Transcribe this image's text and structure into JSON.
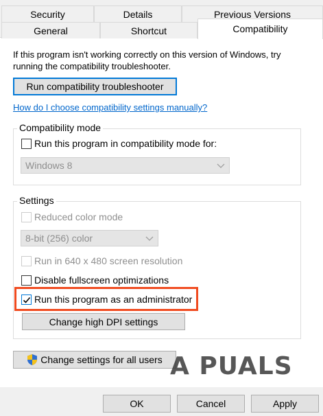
{
  "tabs_back": [
    "Security",
    "Details",
    "Previous Versions"
  ],
  "tabs_front": [
    "General",
    "Shortcut",
    "Compatibility"
  ],
  "intro_line1": "If this program isn't working correctly on this version of Windows, try",
  "intro_line2": "running the compatibility troubleshooter.",
  "troubleshooter_button": "Run compatibility troubleshooter",
  "manual_link": "How do I choose compatibility settings manually?",
  "compat_mode": {
    "title": "Compatibility mode",
    "checkbox_label": "Run this program in compatibility mode for:",
    "checked": false,
    "os_value": "Windows 8"
  },
  "settings": {
    "title": "Settings",
    "reduced_color": "Reduced color mode",
    "color_value": "8-bit (256) color",
    "resolution": "Run in 640 x 480 screen resolution",
    "fullscreen": "Disable fullscreen optimizations",
    "fullscreen_checked": false,
    "admin": "Run this program as an administrator",
    "admin_checked": true,
    "dpi_button": "Change high DPI settings"
  },
  "all_users_button": "Change settings for all users",
  "footer": {
    "ok": "OK",
    "cancel": "Cancel",
    "apply": "Apply"
  },
  "watermark": "A PUALS",
  "colors": {
    "highlight": "#f04a1e",
    "link": "#0066cc",
    "focus": "#0078d7"
  }
}
